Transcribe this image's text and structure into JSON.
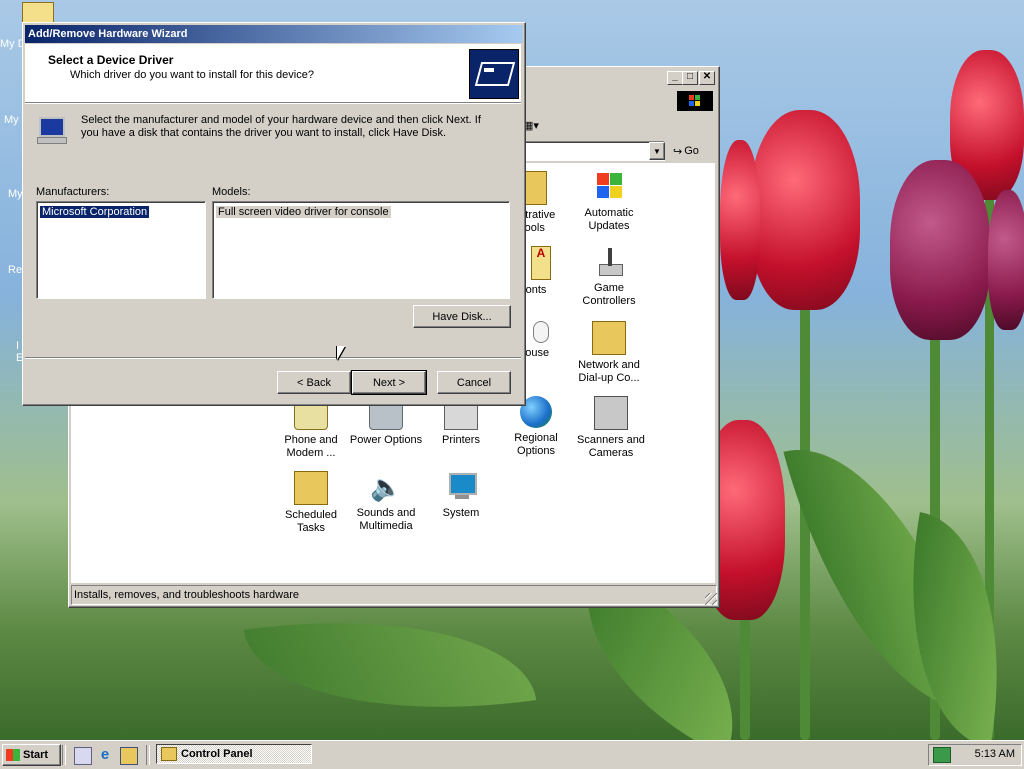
{
  "desktop": {
    "icon_labels": [
      "My D",
      "My",
      "My",
      "Re",
      "I",
      "E"
    ]
  },
  "control_panel": {
    "address_go": "Go",
    "status_text": "Installs, removes, and troubleshoots hardware",
    "icons": [
      {
        "label": "Administrative Tools",
        "partial_label": "inistrative\nTools"
      },
      {
        "label": "Automatic Updates"
      },
      {
        "label": "Fonts",
        "partial_label": "onts"
      },
      {
        "label": "Game Controllers"
      },
      {
        "label": "Mouse",
        "partial_label": "louse"
      },
      {
        "label": "Network and Dial-up Co..."
      },
      {
        "label": "Phone and Modem ..."
      },
      {
        "label": "Power Options"
      },
      {
        "label": "Printers"
      },
      {
        "label": "Regional Options"
      },
      {
        "label": "Scanners and Cameras"
      },
      {
        "label": "Scheduled Tasks"
      },
      {
        "label": "Sounds and Multimedia"
      },
      {
        "label": "System"
      }
    ]
  },
  "wizard": {
    "title": "Add/Remove Hardware Wizard",
    "heading": "Select a Device Driver",
    "subheading": "Which driver do you want to install for this device?",
    "instructions": "Select the manufacturer and model of your hardware device and then click Next. If you have a disk that contains the driver you want to install, click Have Disk.",
    "manufacturers_label": "Manufacturers:",
    "manufacturers": [
      "Microsoft Corporation"
    ],
    "models_label": "Models:",
    "models": [
      "Full screen video driver for console"
    ],
    "have_disk": "Have Disk...",
    "back": "< Back",
    "next": "Next >",
    "cancel": "Cancel"
  },
  "taskbar": {
    "start": "Start",
    "task": "Control Panel",
    "clock": "5:13 AM"
  }
}
